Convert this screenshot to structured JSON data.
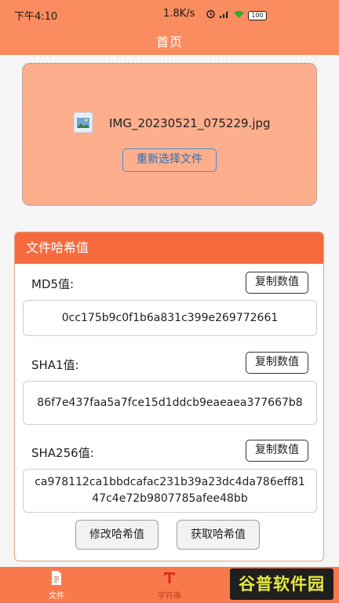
{
  "status_bar": {
    "time": "下午4:10",
    "speed": "1.8K/s",
    "battery": "100"
  },
  "header": {
    "title": "首页"
  },
  "file_card": {
    "file_name": "IMG_20230521_075229.jpg",
    "reselect_label": "重新选择文件"
  },
  "hash_card": {
    "title": "文件哈希值",
    "copy_label": "复制数值",
    "md5": {
      "label": "MD5值:",
      "value": "0cc175b9c0f1b6a831c399e269772661"
    },
    "sha1": {
      "label": "SHA1值:",
      "value": "86f7e437faa5a7fce15d1ddcb9eaeaea377667b8"
    },
    "sha256": {
      "label": "SHA256值:",
      "value": "ca978112ca1bbdcafac231b39a23dc4da786eff8147c4e72b9807785afee48bb"
    },
    "modify_label": "修改哈希值",
    "fetch_label": "获取哈希值"
  },
  "bottom_nav": {
    "items": [
      {
        "label": "文件",
        "icon": "document-icon"
      },
      {
        "label": "字符串",
        "icon": "text-icon"
      }
    ]
  },
  "watermark": {
    "text": "谷普软件园"
  },
  "colors": {
    "header": "#fb8c5f",
    "file_card": "#fcae8d",
    "hash_header": "#f56b3d",
    "bottom_nav": "#f87a4c"
  }
}
